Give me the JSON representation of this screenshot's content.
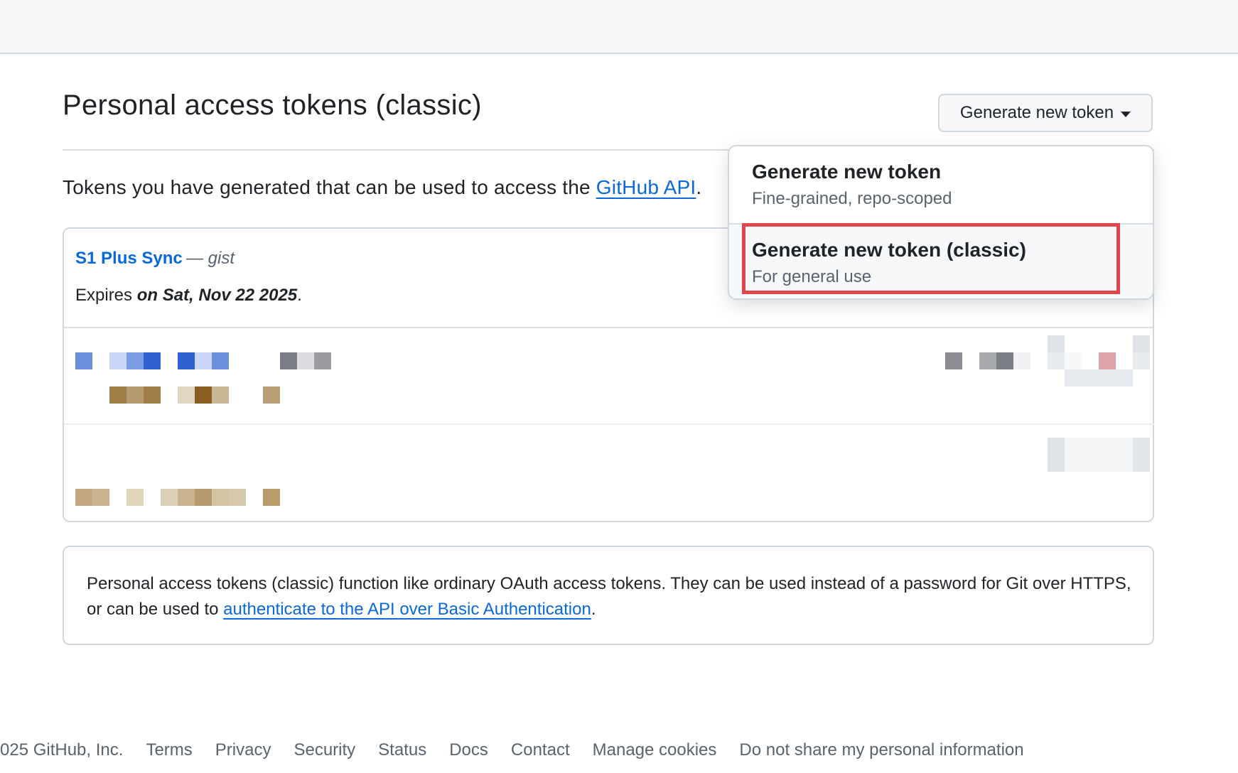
{
  "header": {
    "title": "Personal access tokens (classic)",
    "generate_button_label": "Generate new token"
  },
  "intro": {
    "text_before": "Tokens you have generated that can be used to access the ",
    "link_text": "GitHub API",
    "text_after": "."
  },
  "token": {
    "name": "S1 Plus Sync",
    "note": "— gist",
    "expires_prefix": "Expires ",
    "expires_value": "on Sat, Nov 22 2025",
    "expires_suffix": "."
  },
  "info": {
    "text_before": "Personal access tokens (classic) function like ordinary OAuth access tokens. They can be used instead of a password for Git over HTTPS, or can be used to ",
    "link_text": "authenticate to the API over Basic Authentication",
    "text_after": "."
  },
  "dropdown": {
    "items": [
      {
        "title": "Generate new token",
        "subtitle": "Fine-grained, repo-scoped"
      },
      {
        "title": "Generate new token (classic)",
        "subtitle": "For general use"
      }
    ],
    "highlight_color": "#e0474c"
  },
  "footer": {
    "copyright": "025 GitHub, Inc.",
    "links": [
      "Terms",
      "Privacy",
      "Security",
      "Status",
      "Docs",
      "Contact",
      "Manage cookies",
      "Do not share my personal information"
    ]
  },
  "colors": {
    "link": "#0969da",
    "border": "#d0d7de",
    "muted": "#59636e"
  }
}
